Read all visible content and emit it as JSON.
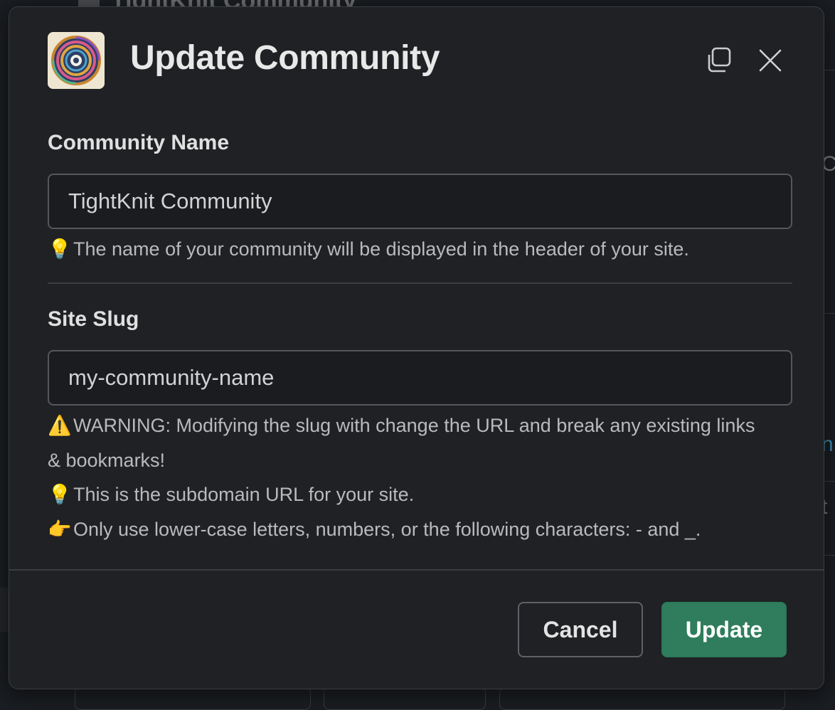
{
  "background": {
    "title": "TightKnit Community",
    "edge_glyphs": [
      "C",
      "n",
      "t"
    ]
  },
  "modal": {
    "title": "Update Community",
    "icons": {
      "app": "community-logo-icon",
      "copy": "copy-window-icon",
      "close": "close-icon",
      "bulb": "💡",
      "warning": "⚠️",
      "pointing": "👉"
    },
    "community_name": {
      "label": "Community Name",
      "value": "TightKnit Community",
      "help": "The name of your community will be displayed in the header of your site."
    },
    "site_slug": {
      "label": "Site Slug",
      "value": "my-community-name",
      "warning_line1": "WARNING: Modifying the slug with change the URL and break any existing links",
      "warning_line2": "& bookmarks!",
      "help": "This is the subdomain URL for your site.",
      "rules": "Only use lower-case letters, numbers, or the following characters: - and _."
    },
    "buttons": {
      "cancel": "Cancel",
      "update": "Update"
    }
  },
  "colors": {
    "primary_button": "#2f7d5c",
    "modal_bg": "#1f2124",
    "page_bg": "#1a1d21"
  }
}
